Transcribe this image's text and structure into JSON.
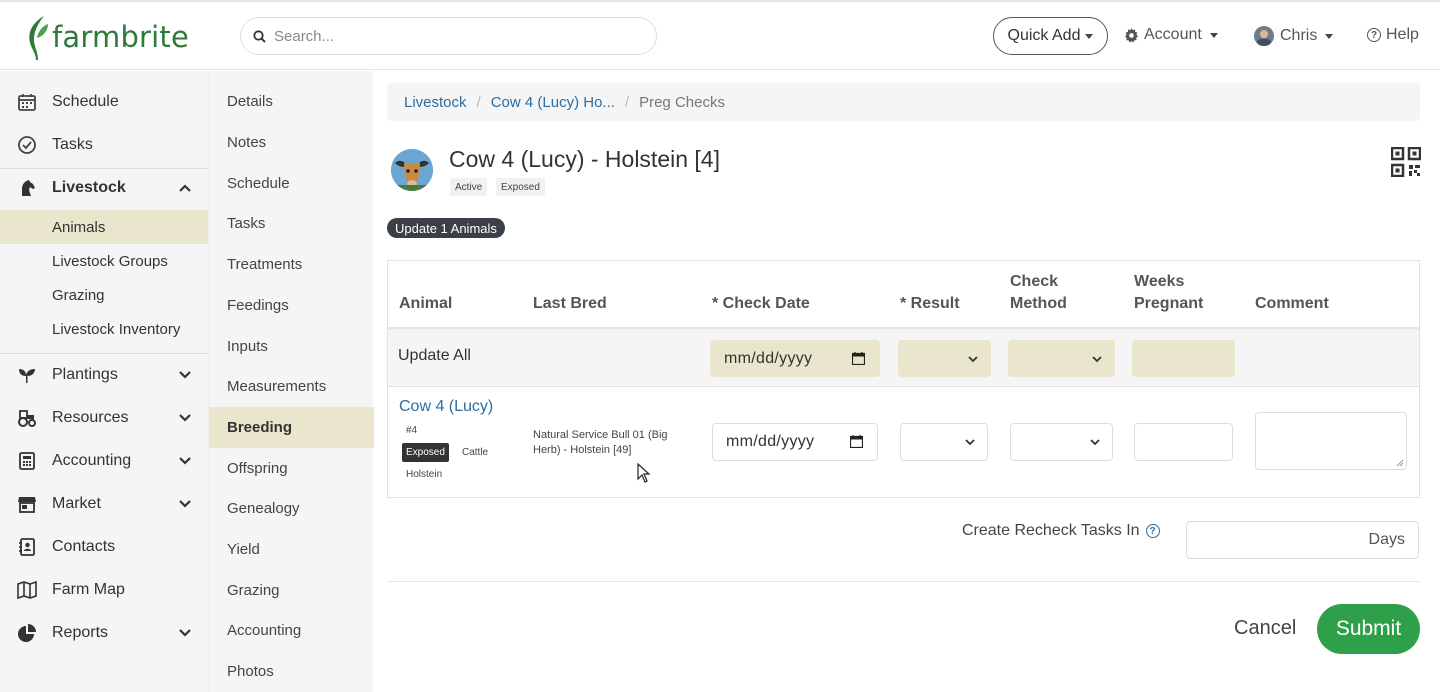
{
  "header": {
    "brand": "farmbrite",
    "search_placeholder": "Search...",
    "quick_add": "Quick Add",
    "account": "Account",
    "user": "Chris",
    "help": "Help"
  },
  "mainnav": {
    "items": [
      {
        "label": "Schedule",
        "icon": "calendar-icon"
      },
      {
        "label": "Tasks",
        "icon": "check-circle-icon"
      },
      {
        "label": "Livestock",
        "icon": "horse-head-icon",
        "expanded": true
      },
      {
        "label": "Plantings",
        "icon": "seedling-icon"
      },
      {
        "label": "Resources",
        "icon": "tractor-icon"
      },
      {
        "label": "Accounting",
        "icon": "calculator-icon"
      },
      {
        "label": "Market",
        "icon": "store-icon"
      },
      {
        "label": "Contacts",
        "icon": "address-book-icon"
      },
      {
        "label": "Farm Map",
        "icon": "map-icon"
      },
      {
        "label": "Reports",
        "icon": "pie-chart-icon"
      }
    ],
    "livestock_sub": [
      "Animals",
      "Livestock Groups",
      "Grazing",
      "Livestock Inventory"
    ]
  },
  "subnav": {
    "items": [
      "Details",
      "Notes",
      "Schedule",
      "Tasks",
      "Treatments",
      "Feedings",
      "Inputs",
      "Measurements",
      "Breeding",
      "Offspring",
      "Genealogy",
      "Yield",
      "Grazing",
      "Accounting",
      "Photos"
    ],
    "active": "Breeding"
  },
  "breadcrumb": {
    "livestock": "Livestock",
    "animal": "Cow 4 (Lucy) Ho...",
    "current": "Preg Checks"
  },
  "animal": {
    "title": "Cow 4 (Lucy) - Holstein [4]",
    "tag_status": "Active",
    "tag_breeding": "Exposed"
  },
  "update_badge": "Update 1 Animals",
  "table": {
    "headers": {
      "animal": "Animal",
      "last_bred": "Last Bred",
      "check_date": "* Check Date",
      "result": "* Result",
      "check_method_1": "Check",
      "check_method_2": "Method",
      "weeks_1": "Weeks",
      "weeks_2": "Pregnant",
      "comment": "Comment"
    },
    "update_all": "Update All",
    "date_placeholder": "mm/dd/yyyy",
    "row": {
      "name": "Cow 4 (Lucy)",
      "number": "#4",
      "status": "Exposed",
      "species": "Cattle",
      "breed": "Holstein",
      "last_bred": "Natural Service Bull 01 (Big Herb) - Holstein [49]"
    }
  },
  "recheck": {
    "label": "Create Recheck Tasks In",
    "unit": "Days"
  },
  "actions": {
    "cancel": "Cancel",
    "submit": "Submit"
  },
  "colors": {
    "brand_green": "#2f7a3b",
    "submit_green": "#2ea04a",
    "link_blue": "#2a6ea4",
    "highlight": "#e9e6cd"
  }
}
